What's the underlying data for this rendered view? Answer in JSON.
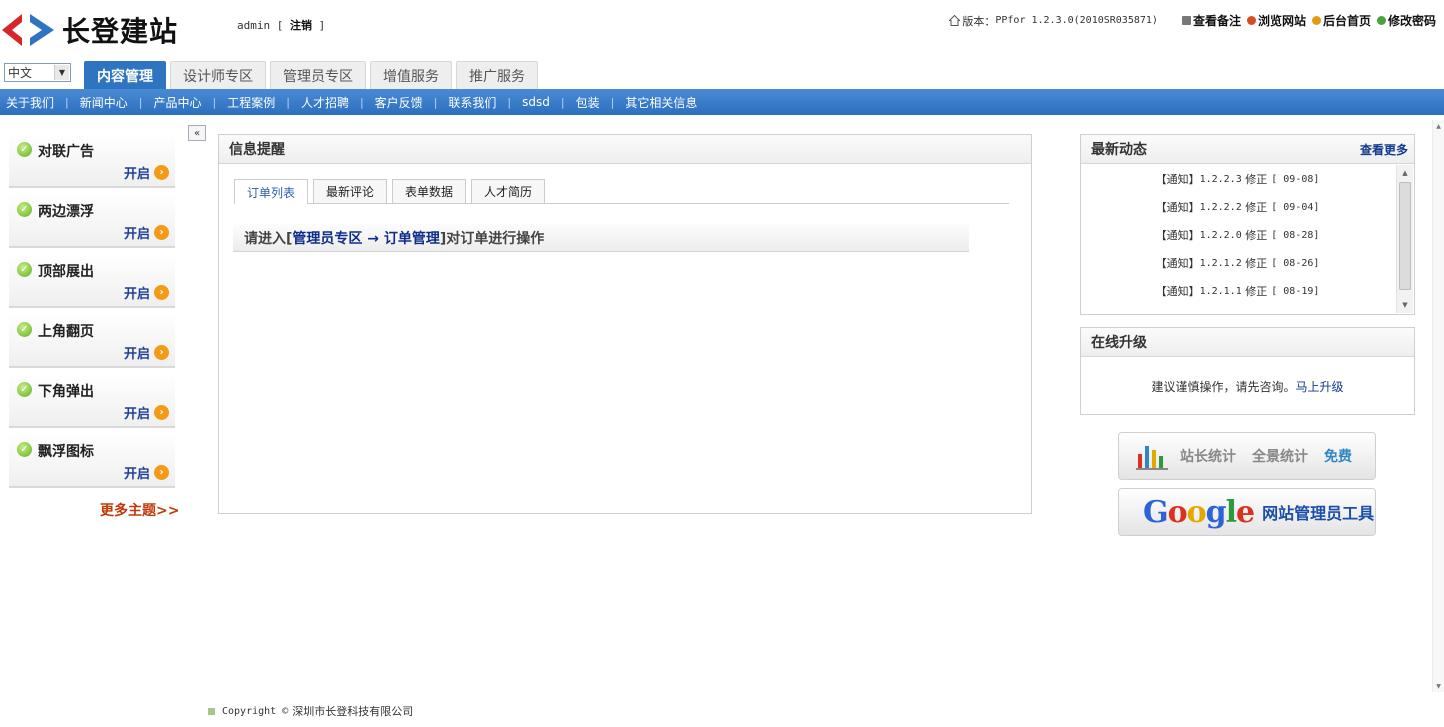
{
  "brand": {
    "name": "长登建站",
    "colors": {
      "blue": "#2f74c0",
      "red": "#d6262a"
    }
  },
  "header": {
    "user": "admin",
    "bracket_open": "[",
    "logout": "注销",
    "bracket_close": "]",
    "version_label": "版本：",
    "version_value": "PPfor 1.2.3.0(2010SR035871)",
    "links": [
      {
        "label": "查看备注",
        "icon": "note-icon",
        "color": "#666666"
      },
      {
        "label": "浏览网站",
        "icon": "globe-icon",
        "color": "#d94c1f"
      },
      {
        "label": "后台首页",
        "icon": "home-circle-icon",
        "color": "#e39b12"
      },
      {
        "label": "修改密码",
        "icon": "key-icon",
        "color": "#4aa33a"
      }
    ]
  },
  "language": {
    "selected": "中文"
  },
  "main_tabs": [
    {
      "label": "内容管理",
      "active": true
    },
    {
      "label": "设计师专区",
      "active": false
    },
    {
      "label": "管理员专区",
      "active": false
    },
    {
      "label": "增值服务",
      "active": false
    },
    {
      "label": "推广服务",
      "active": false
    }
  ],
  "sub_nav": [
    {
      "label": "关于我们"
    },
    {
      "label": "新闻中心"
    },
    {
      "label": "产品中心"
    },
    {
      "label": "工程案例"
    },
    {
      "label": "人才招聘"
    },
    {
      "label": "客户反馈"
    },
    {
      "label": "联系我们"
    },
    {
      "label": "sdsd"
    },
    {
      "label": "包装"
    },
    {
      "label": "其它相关信息"
    }
  ],
  "sidebar": {
    "collapse_label": "«",
    "items": [
      {
        "name": "对联广告",
        "action": "开启"
      },
      {
        "name": "两边漂浮",
        "action": "开启"
      },
      {
        "name": "顶部展出",
        "action": "开启"
      },
      {
        "name": "上角翻页",
        "action": "开启"
      },
      {
        "name": "下角弹出",
        "action": "开启"
      },
      {
        "name": "飘浮图标",
        "action": "开启"
      }
    ],
    "more_label": "更多主题>>"
  },
  "info_panel": {
    "title": "信息提醒",
    "tabs": [
      {
        "label": "订单列表",
        "active": true
      },
      {
        "label": "最新评论",
        "active": false
      },
      {
        "label": "表单数据",
        "active": false
      },
      {
        "label": "人才简历",
        "active": false
      }
    ],
    "notice": {
      "prefix": "请进入[",
      "link": "管理员专区 → 订单管理",
      "suffix": "]对订单进行操作"
    }
  },
  "news": {
    "title": "最新动态",
    "more": "查看更多",
    "items": [
      {
        "tag": "【通知】",
        "version": "1.2.2.3",
        "action": "修正",
        "date": "[ 09-08]"
      },
      {
        "tag": "【通知】",
        "version": "1.2.2.2",
        "action": "修正",
        "date": "[ 09-04]"
      },
      {
        "tag": "【通知】",
        "version": "1.2.2.0",
        "action": "修正",
        "date": "[ 08-28]"
      },
      {
        "tag": "【通知】",
        "version": "1.2.1.2",
        "action": "修正",
        "date": "[ 08-26]"
      },
      {
        "tag": "【通知】",
        "version": "1.2.1.1",
        "action": "修正",
        "date": "[ 08-19]"
      }
    ]
  },
  "upgrade": {
    "title": "在线升级",
    "text": "建议谨慎操作，请先咨询。",
    "link": "马上升级"
  },
  "promos": {
    "stats": {
      "label1": "站长统计",
      "label2": "全景统计",
      "label3": "免费"
    },
    "google": {
      "tool_label": "网站管理员工具"
    }
  },
  "footer": {
    "copyright": "Copyright ©",
    "company": "深圳市长登科技有限公司"
  }
}
